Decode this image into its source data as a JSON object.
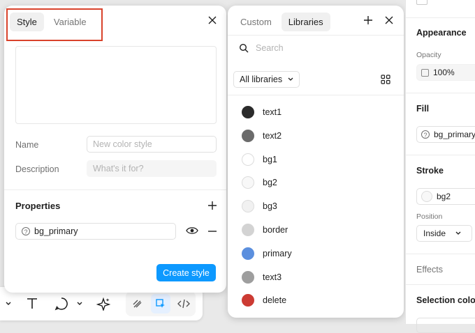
{
  "style_panel": {
    "tabs": [
      {
        "label": "Style",
        "active": true
      },
      {
        "label": "Variable",
        "active": false
      }
    ],
    "name_label": "Name",
    "name_placeholder": "New color style",
    "description_label": "Description",
    "description_placeholder": "What's it for?",
    "properties_title": "Properties",
    "property_value": "bg_primary",
    "create_button": "Create style"
  },
  "libraries_panel": {
    "tabs": [
      {
        "label": "Custom",
        "active": false
      },
      {
        "label": "Libraries",
        "active": true
      }
    ],
    "search_placeholder": "Search",
    "filter_label": "All libraries",
    "items": [
      {
        "label": "text1",
        "color": "#2b2b2b"
      },
      {
        "label": "text2",
        "color": "#6b6b6b"
      },
      {
        "label": "bg1",
        "color": "#ffffff"
      },
      {
        "label": "bg2",
        "color": "#f8f8f8"
      },
      {
        "label": "bg3",
        "color": "#f1f1f1"
      },
      {
        "label": "border",
        "color": "#d3d3d3"
      },
      {
        "label": "primary",
        "color": "#5b8fde"
      },
      {
        "label": "text3",
        "color": "#9e9e9e"
      },
      {
        "label": "delete",
        "color": "#cc3b33"
      }
    ]
  },
  "properties_sidebar": {
    "appearance_title": "Appearance",
    "opacity_label": "Opacity",
    "opacity_value": "100%",
    "fill_title": "Fill",
    "fill_value": "bg_primary",
    "stroke_title": "Stroke",
    "stroke_value": "bg2",
    "position_label": "Position",
    "position_value": "Inside",
    "effects_title": "Effects",
    "selection_colors_title": "Selection colors"
  },
  "colors": {
    "accent": "#0d99ff",
    "highlight": "#d9422b"
  }
}
